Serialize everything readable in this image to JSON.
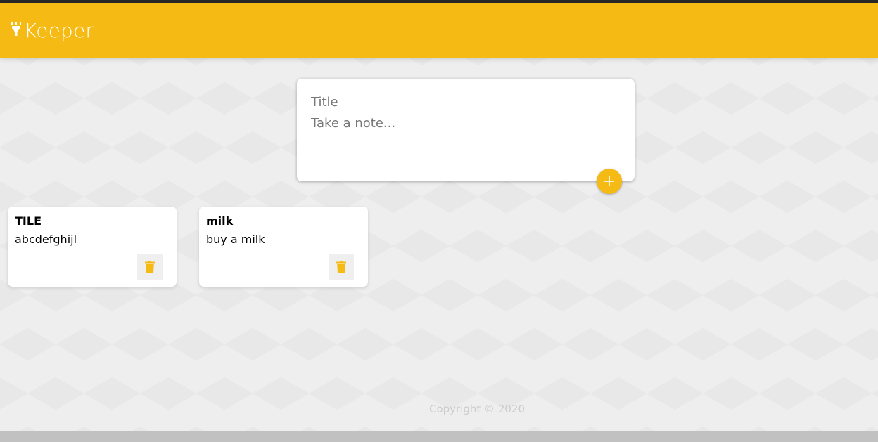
{
  "app": {
    "title": "Keeper",
    "icon": "highlighter-icon",
    "accent_color": "#f5ba13"
  },
  "composer": {
    "title_placeholder": "Title",
    "content_placeholder": "Take a note...",
    "add_button_label": "+",
    "add_icon": "plus-icon"
  },
  "notes": [
    {
      "title": "TILE",
      "content": "abcdefghijl",
      "delete_icon": "trash-icon"
    },
    {
      "title": "milk",
      "content": "buy a milk",
      "delete_icon": "trash-icon"
    }
  ],
  "footer": {
    "copyright": "Copyright © 2020"
  }
}
